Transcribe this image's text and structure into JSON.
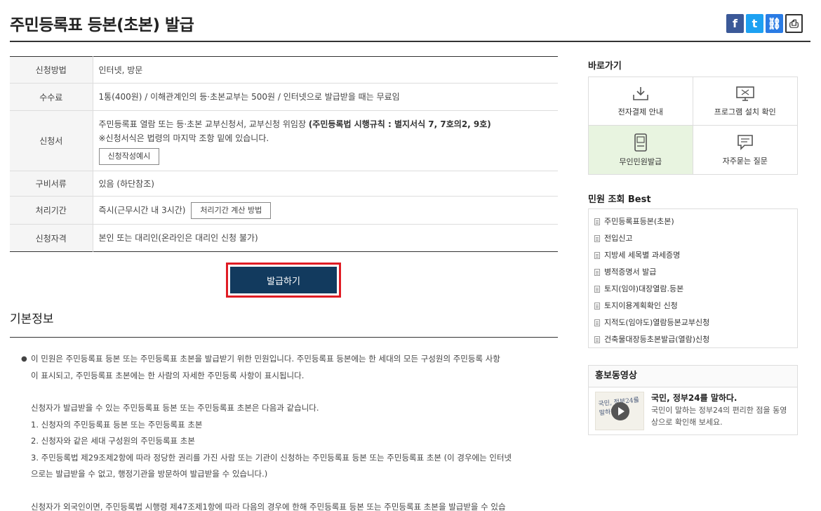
{
  "header": {
    "title": "주민등록표 등본(초본) 발급",
    "share": {
      "facebook": "f",
      "twitter": "t",
      "link": "⛓",
      "print": "⎙"
    }
  },
  "info": {
    "rows": [
      {
        "label": "신청방법",
        "value": "인터넷, 방문"
      },
      {
        "label": "수수료",
        "value": "1통(400원) / 이해관계인의 등·초본교부는 500원 / 인터넷으로 발급받을 때는 무료임"
      },
      {
        "label": "신청서",
        "line1": "주민등록표 열람 또는 등·초본 교부신청서, 교부신청 위임장 ",
        "line1_bold": "(주민등록법 시행규칙 : 별지서식 7, 7호의2, 9호)",
        "line2": "※신청서식은 법령의 마지막 조항 밑에 있습니다.",
        "button": "신청작성예시"
      },
      {
        "label": "구비서류",
        "value": "있음 (하단참조)"
      },
      {
        "label": "처리기간",
        "value": "즉시(근무시간 내 3시간)",
        "button": "처리기간 계산 방법"
      },
      {
        "label": "신청자격",
        "value": "본인 또는 대리인(온라인은 대리인 신청 불가)"
      }
    ]
  },
  "issue_button": "발급하기",
  "basic": {
    "title": "기본정보",
    "bullet": "●",
    "lines": [
      "이 민원은 주민등록표 등본 또는 주민등록표 초본을 발급받기 위한 민원입니다. 주민등록표 등본에는 한 세대의 모든 구성원의 주민등록 사항",
      "이 표시되고, 주민등록표 초본에는 한 사람의 자세한 주민등록 사항이 표시됩니다.",
      "신청자가 발급받을 수 있는 주민등록표 등본 또는 주민등록표 초본은 다음과 같습니다.",
      "1. 신청자의 주민등록표 등본 또는 주민등록표 초본",
      "2. 신청자와 같은 세대 구성원의 주민등록표 초본",
      "3. 주민등록법 제29조제2항에 따라 정당한 권리를 가진 사람 또는 기관이 신청하는 주민등록표 등본 또는 주민등록표 초본 (이 경우에는 인터넷",
      "으로는 발급받을 수 없고, 행정기관을 방문하여 발급받을 수 있습니다.)",
      "신청자가 외국인이면, 주민등록법 시행령 제47조제1항에 따라 다음의 경우에 한해 주민등록표 등본 또는 주민등록표 초본을 발급받을 수 있습"
    ]
  },
  "sidebar": {
    "quick_title": "바로가기",
    "quick": [
      {
        "label": "전자결제 안내",
        "icon": "download-tray-icon"
      },
      {
        "label": "프로그램 설치 확인",
        "icon": "monitor-icon"
      },
      {
        "label": "무인민원발급",
        "icon": "kiosk-icon"
      },
      {
        "label": "자주묻는 질문",
        "icon": "speech-bubble-icon"
      }
    ],
    "best_title": "민원 조회 Best",
    "best": [
      "주민등록표등본(초본)",
      "전입신고",
      "지방세 세목별 과세증명",
      "병적증명서 발급",
      "토지(임야)대장열람.등본",
      "토지이용계획확인 신청",
      "지적도(임야도)열람등본교부신청",
      "건축물대장등초본발급(열람)신청"
    ],
    "promo": {
      "title": "홍보동영상",
      "thumb_text": "국민, 정부24를 말하다",
      "video_title": "국민, 정부24를 말하다.",
      "video_desc": "국민이 말하는 정부24의 편리한 점을 동영상으로 확인해 보세요."
    }
  },
  "colors": {
    "primary_button": "#123a5e",
    "highlight_border": "#e01c24",
    "active_cell": "#e8f4e0"
  }
}
